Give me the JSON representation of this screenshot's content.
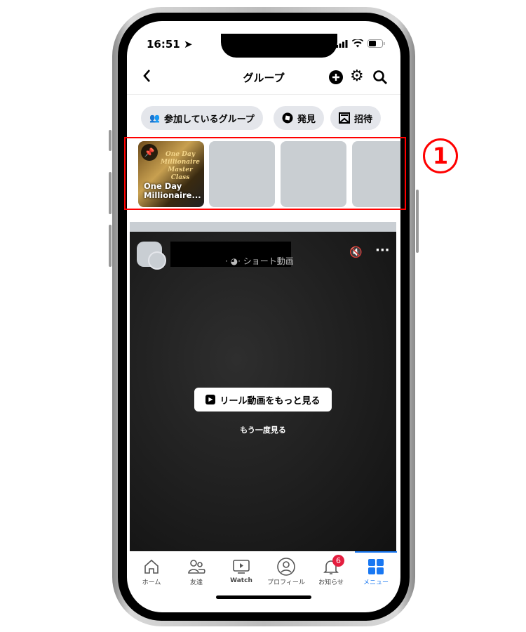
{
  "status_bar": {
    "time": "16:51"
  },
  "header": {
    "title": "グループ",
    "back_icon": "chevron-left-icon",
    "actions": [
      "plus-circle-icon",
      "gear-icon",
      "search-icon"
    ]
  },
  "chips": [
    {
      "label": "参加しているグループ",
      "icon": "people-icon"
    },
    {
      "label": "発見",
      "icon": "compass-icon"
    },
    {
      "label": "招待",
      "icon": "envelope-icon"
    }
  ],
  "groups": [
    {
      "name": "One Day Millionaire...",
      "pinned": true,
      "banner_text": "One Day Millionaire Master Class"
    }
  ],
  "post": {
    "meta": "· ショート動画",
    "reels_button": "リール動画をもっと見る",
    "replay": "もう一度見る"
  },
  "tabbar": [
    {
      "label": "ホーム",
      "icon": "home-icon"
    },
    {
      "label": "友達",
      "icon": "friends-icon"
    },
    {
      "label": "Watch",
      "icon": "watch-icon"
    },
    {
      "label": "プロフィール",
      "icon": "profile-icon"
    },
    {
      "label": "お知らせ",
      "icon": "bell-icon",
      "badge": "6"
    },
    {
      "label": "メニュー",
      "icon": "menu-grid-icon",
      "active": true
    }
  ],
  "annotation": {
    "label": "1",
    "color": "#ff0000"
  },
  "colors": {
    "accent": "#1877f2",
    "badge": "#e41e3f"
  }
}
